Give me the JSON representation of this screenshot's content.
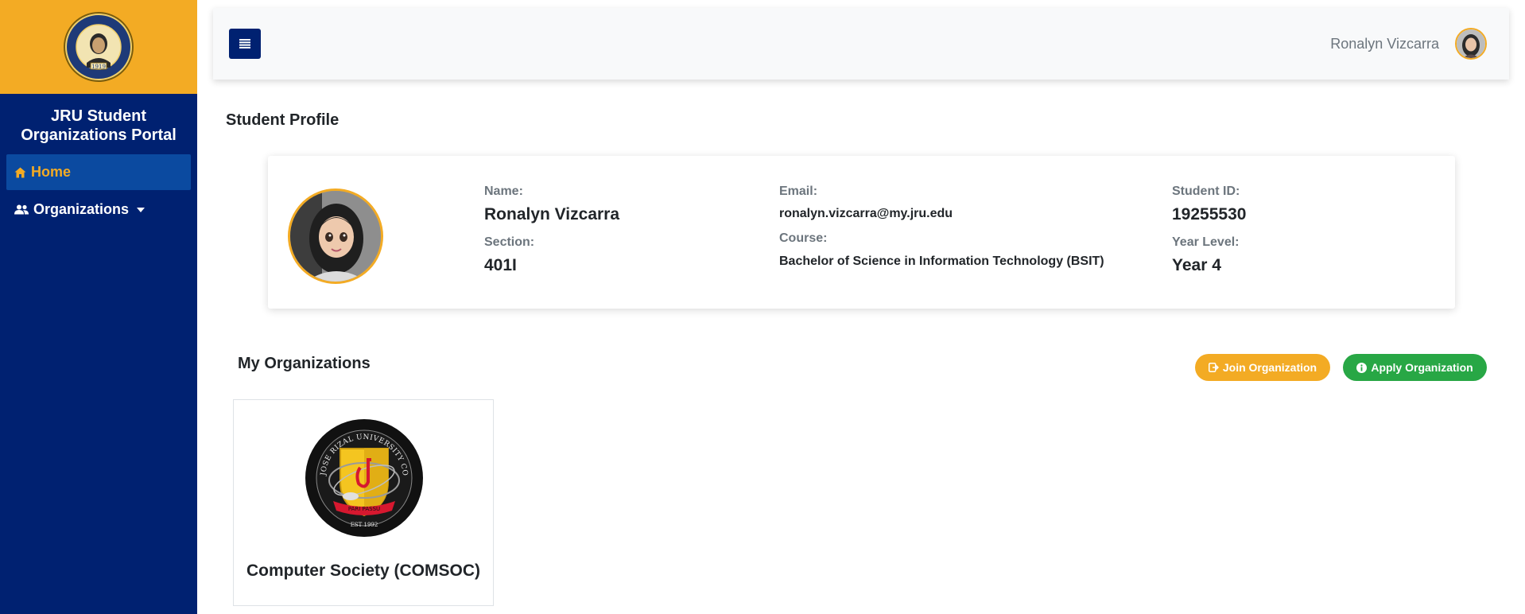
{
  "sidebar": {
    "logo_text": "JOSE RIZAL UNIVERSITY",
    "logo_year": "1919",
    "brand": "JRU Student Organizations Portal",
    "items": [
      {
        "label": "Home",
        "icon": "home-icon",
        "active": true
      },
      {
        "label": "Organizations",
        "icon": "users-icon",
        "active": false
      }
    ]
  },
  "topbar": {
    "user_name": "Ronalyn Vizcarra"
  },
  "profile": {
    "title": "Student Profile",
    "name_label": "Name:",
    "name": "Ronalyn Vizcarra",
    "section_label": "Section:",
    "section": "401I",
    "email_label": "Email:",
    "email": "ronalyn.vizcarra@my.jru.edu",
    "course_label": "Course:",
    "course": "Bachelor of Science in Information Technology (BSIT)",
    "student_id_label": "Student ID:",
    "student_id": "19255530",
    "year_label": "Year Level:",
    "year": "Year 4"
  },
  "organizations": {
    "title": "My Organizations",
    "join_label": "Join Organization",
    "apply_label": "Apply Organization",
    "cards": [
      {
        "name": "Computer Society (COMSOC)",
        "logo_ring_text": "JOSE RIZAL UNIVERSITY COMPUTER SOCIETY",
        "logo_banner": "PARI PASSU",
        "logo_est": "EST 1992"
      }
    ]
  },
  "colors": {
    "navy": "#002171",
    "gold": "#f3ab24",
    "active_blue": "#0b4aa0",
    "green": "#28a745"
  }
}
